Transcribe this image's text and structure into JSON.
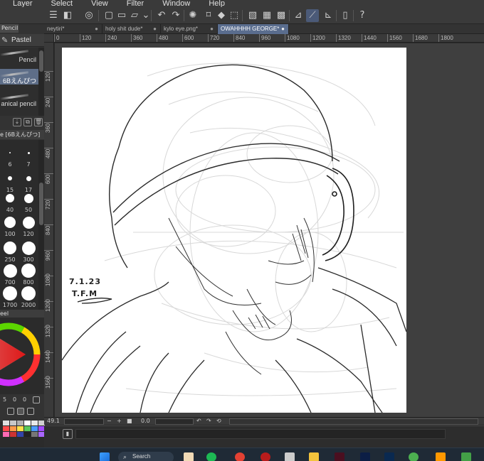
{
  "menu": [
    "Layer",
    "Select",
    "View",
    "Filter",
    "Window",
    "Help"
  ],
  "command_icons": [
    "hamburger-menu-icon",
    "new-file-icon",
    "ellipse-tool-icon",
    "open-folder-icon",
    "save-icon",
    "save-cloud-icon",
    "undo-icon",
    "redo-icon",
    "loading-spinner-icon",
    "clear-icon",
    "fill-icon",
    "transform-icon",
    "snap-to-ruler-icon",
    "snap-to-grid-icon",
    "snap-to-special-icon",
    "stabilizer-icon",
    "stroke-correction-icon",
    "vector-icon",
    "smartphone-icon",
    "help-icon"
  ],
  "left": {
    "subtab": "Pencil",
    "group_label": "Pastel",
    "brushes": [
      {
        "label": "Pencil",
        "selected": false
      },
      {
        "label": "6Bえんぴつ",
        "selected": true
      },
      {
        "label": "anical pencil",
        "selected": false
      }
    ],
    "size_header": "e [6Bえんぴつ]",
    "sizes": [
      "6",
      "7",
      "15",
      "17",
      "40",
      "50",
      "100",
      "120",
      "250",
      "300",
      "700",
      "800",
      "1700",
      "2000"
    ],
    "color_header": "eel",
    "color_values": [
      "5",
      "0",
      "0"
    ],
    "palette": [
      "#e0e0e0",
      "#c8c8c8",
      "#b0b0b0",
      "#ffffff",
      "#e8e8e8",
      "#d0d0d0",
      "#ff4a4a",
      "#ff9a4a",
      "#ffe14a",
      "#5ac85a",
      "#4a9aff",
      "#a44aff",
      "#ff6ab4",
      "#cc3333",
      "#3344aa",
      "#222222",
      "#777777",
      "#aa66ff"
    ]
  },
  "doc_tabs": [
    {
      "label": "neytiri*",
      "active": false
    },
    {
      "label": "holy shit dude*",
      "active": false
    },
    {
      "label": "kylo eye.png*",
      "active": false
    },
    {
      "label": "OWAHHHH GEORGE*",
      "active": true
    }
  ],
  "ruler_h": [
    "0",
    "120",
    "240",
    "360",
    "480",
    "600",
    "720",
    "840",
    "960",
    "1080",
    "1200",
    "1320",
    "1440",
    "1560",
    "1680",
    "1800"
  ],
  "ruler_v": [
    "120",
    "240",
    "360",
    "480",
    "600",
    "720",
    "840",
    "960",
    "1080",
    "1200",
    "1320",
    "1440",
    "1560"
  ],
  "signature": {
    "date": "7.1.23",
    "initials": "T.F.M"
  },
  "status": {
    "zoom": "49.1",
    "angle": "0.0"
  },
  "taskbar": {
    "search": "Search"
  }
}
